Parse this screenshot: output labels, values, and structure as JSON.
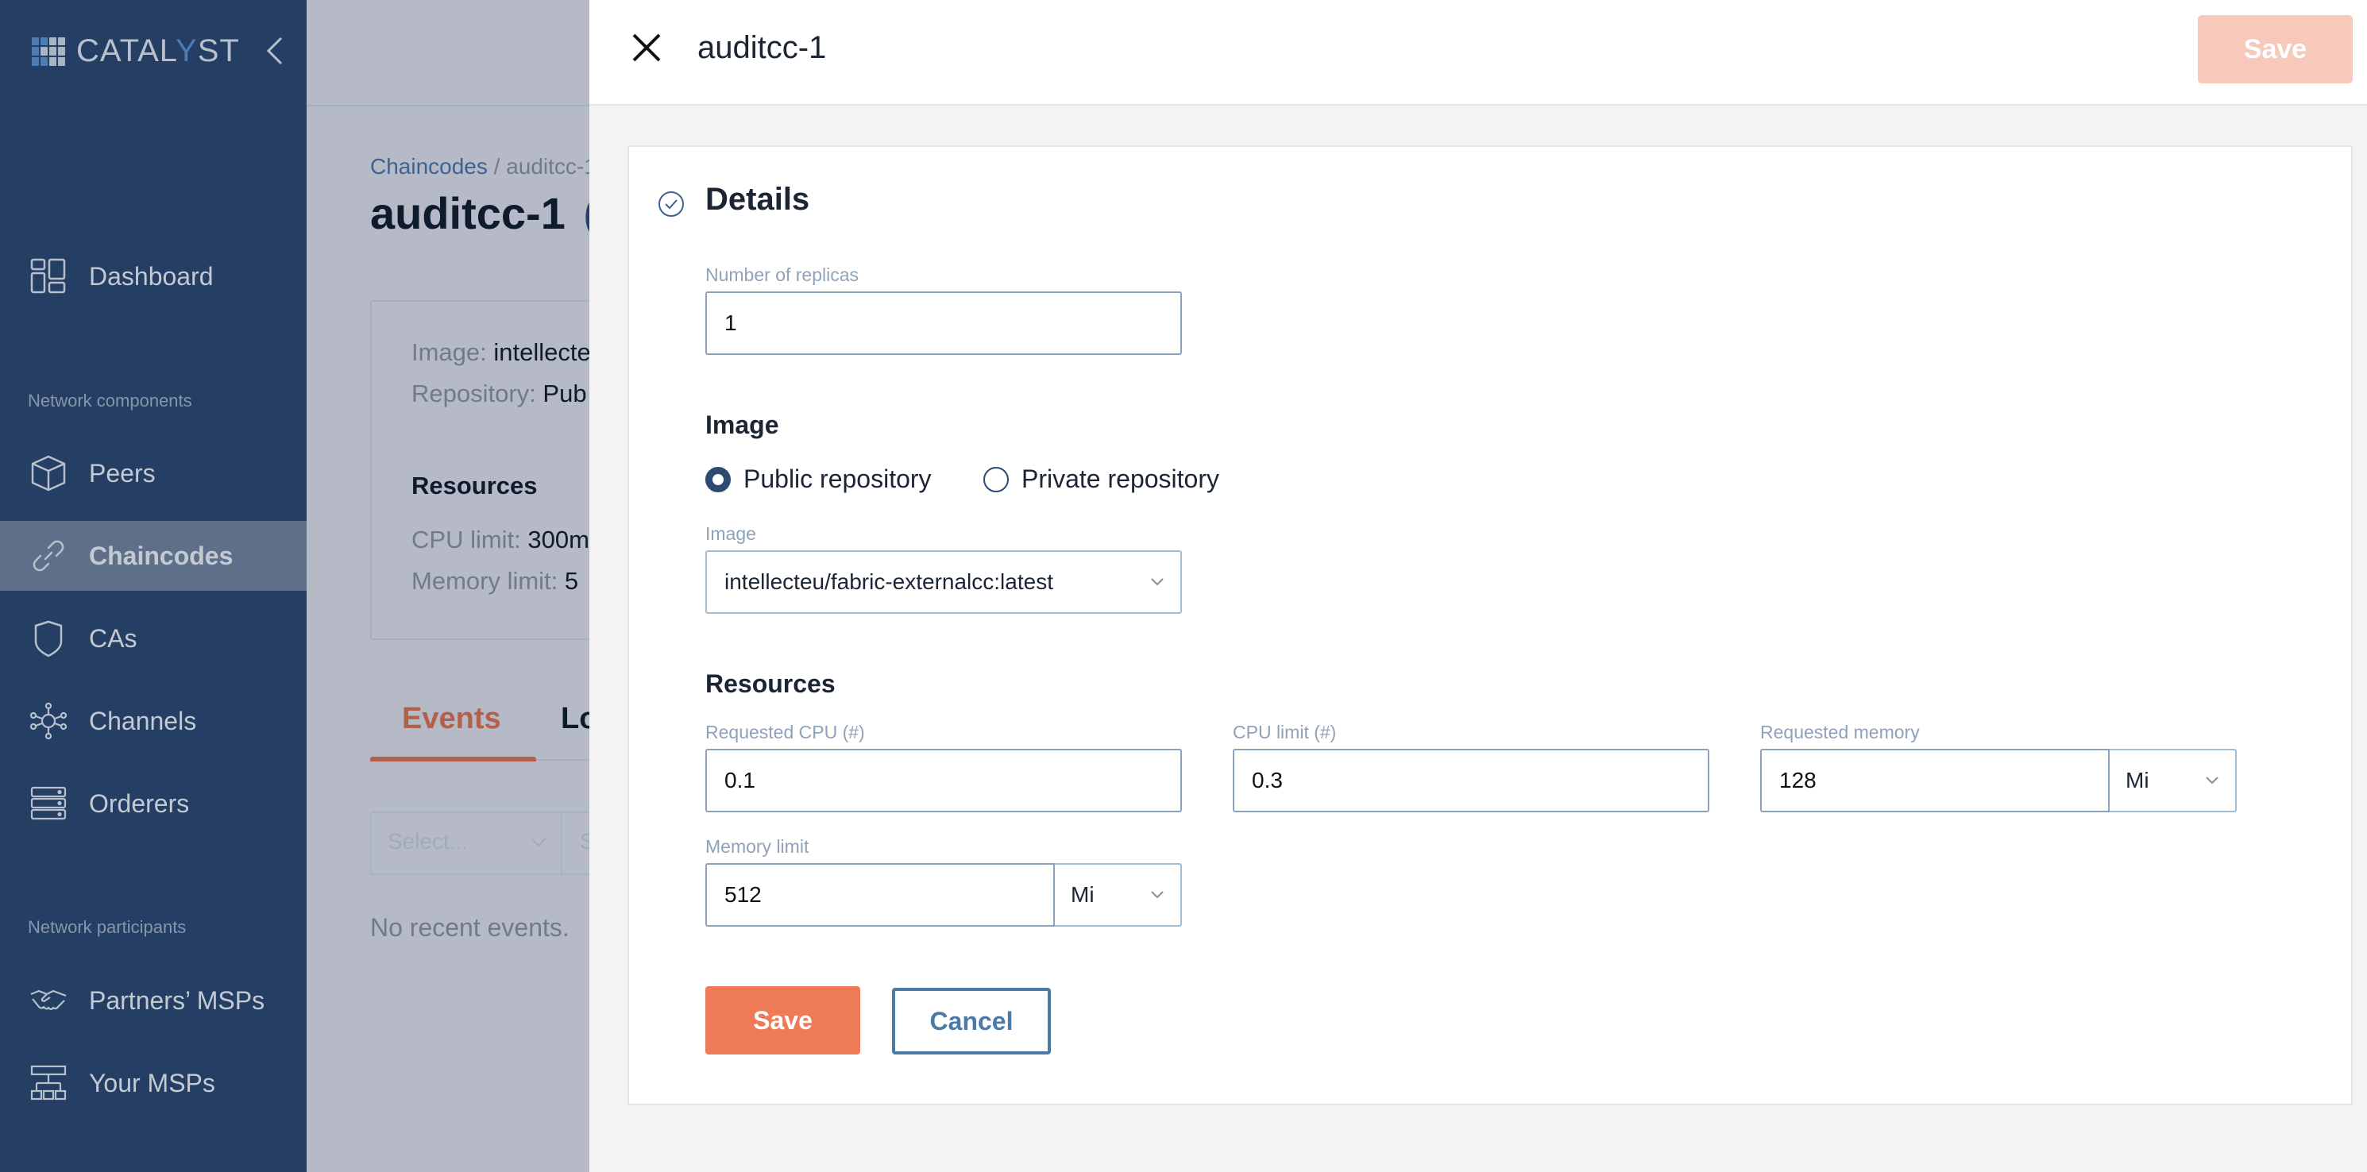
{
  "app": {
    "logo_text_a": "CATAL",
    "logo_text_y": "Y",
    "logo_text_b": "ST"
  },
  "sidebar": {
    "top_items": [
      {
        "label": "Dashboard",
        "icon": "dashboard-icon"
      }
    ],
    "section_network_components": "Network components",
    "network_components": [
      {
        "label": "Peers",
        "icon": "cube-icon"
      },
      {
        "label": "Chaincodes",
        "icon": "link-icon",
        "active": true
      },
      {
        "label": "CAs",
        "icon": "shield-icon"
      },
      {
        "label": "Channels",
        "icon": "network-hub-icon"
      },
      {
        "label": "Orderers",
        "icon": "server-stack-icon"
      }
    ],
    "section_network_participants": "Network participants",
    "network_participants": [
      {
        "label": "Partners’ MSPs",
        "icon": "handshake-icon"
      },
      {
        "label": "Your MSPs",
        "icon": "org-chart-icon"
      }
    ]
  },
  "background_page": {
    "breadcrumb": {
      "parent": "Chaincodes",
      "separator": "/",
      "current": "auditcc-1"
    },
    "title": "auditcc-1",
    "title_suffix": "(",
    "info": {
      "image_key": "Image:",
      "image_value": "intellecte",
      "repository_key": "Repository:",
      "repository_value": "Pub",
      "resources_heading": "Resources",
      "cpu_limit_key": "CPU limit:",
      "cpu_limit_value": "300m",
      "memory_limit_key": "Memory limit:",
      "memory_limit_value": "5"
    },
    "tabs": [
      {
        "label": "Events",
        "active": true
      },
      {
        "label": "Lo"
      }
    ],
    "filter_placeholder": "Select...",
    "filter_placeholder_2": "S",
    "empty_message": "No recent events."
  },
  "drawer": {
    "title": "auditcc-1",
    "top_save_label": "Save",
    "section_title": "Details",
    "replicas": {
      "label": "Number of replicas",
      "value": "1"
    },
    "image_heading": "Image",
    "repository_options": [
      {
        "label": "Public repository",
        "checked": true
      },
      {
        "label": "Private repository",
        "checked": false
      }
    ],
    "image_select": {
      "label": "Image",
      "value": "intellecteu/fabric-externalcc:latest"
    },
    "resources_heading": "Resources",
    "requested_cpu": {
      "label": "Requested CPU (#)",
      "value": "0.1"
    },
    "cpu_limit": {
      "label": "CPU limit (#)",
      "value": "0.3"
    },
    "requested_memory": {
      "label": "Requested memory",
      "value": "128",
      "unit": "Mi"
    },
    "memory_limit": {
      "label": "Memory limit",
      "value": "512",
      "unit": "Mi"
    },
    "save_label": "Save",
    "cancel_label": "Cancel"
  },
  "colors": {
    "sidebar_bg": "#243e64",
    "sidebar_active": "#5e6f8a",
    "accent": "#ee7a57",
    "accent_disabled": "#f6c9bb",
    "secondary": "#4c7aa4",
    "overlay": "#b5bac6"
  }
}
